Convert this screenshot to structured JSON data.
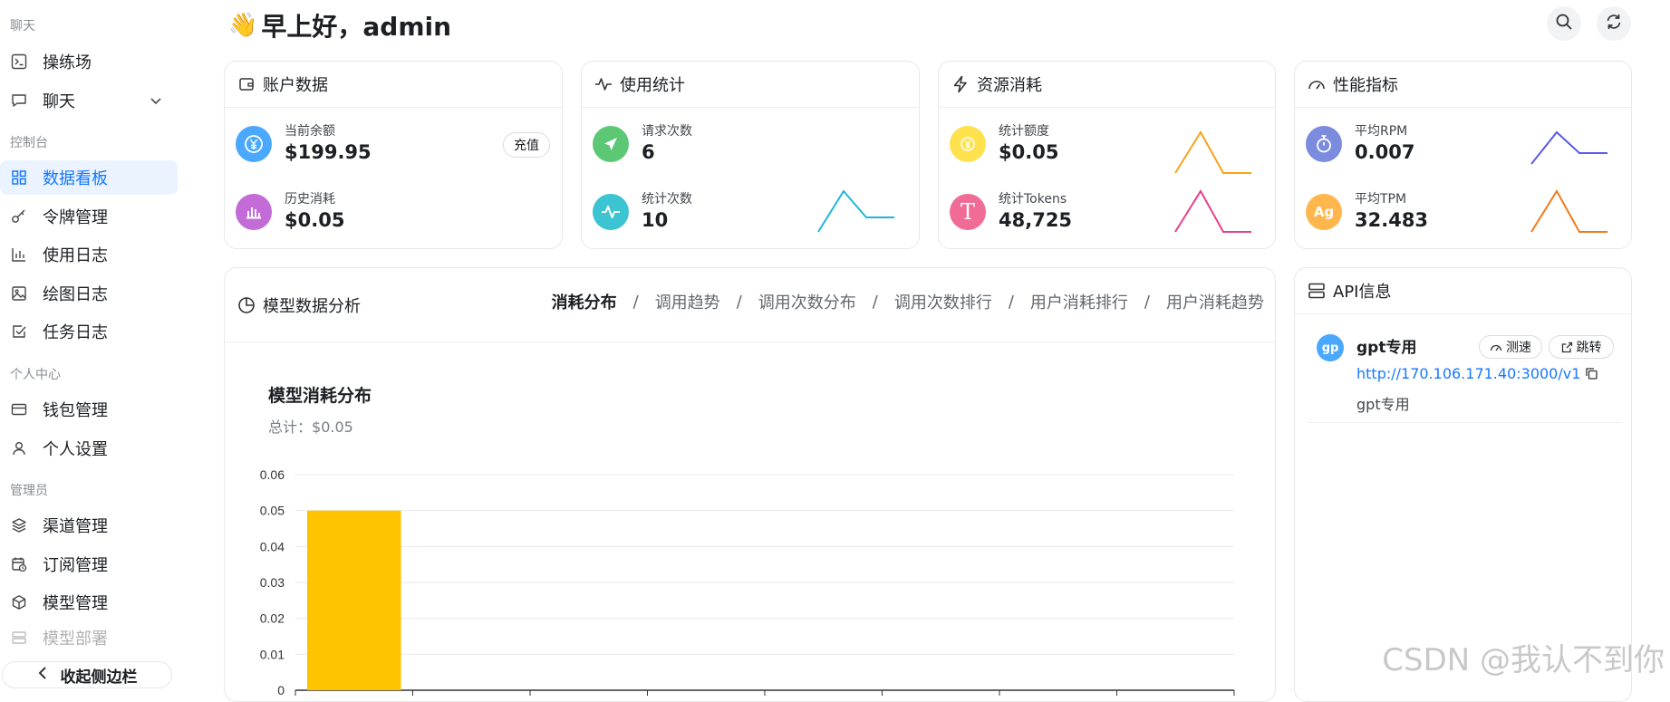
{
  "sidebar": {
    "sections": [
      {
        "title": "聊天",
        "items": [
          {
            "label": "操练场",
            "icon": "terminal-icon"
          },
          {
            "label": "聊天",
            "icon": "chat-bubble-icon",
            "expandable": true
          }
        ]
      },
      {
        "title": "控制台",
        "items": [
          {
            "label": "数据看板",
            "icon": "dashboard-grid-icon",
            "active": true
          },
          {
            "label": "令牌管理",
            "icon": "key-icon"
          },
          {
            "label": "使用日志",
            "icon": "bar-chart-icon"
          },
          {
            "label": "绘图日志",
            "icon": "image-icon"
          },
          {
            "label": "任务日志",
            "icon": "checkbox-icon"
          }
        ]
      },
      {
        "title": "个人中心",
        "items": [
          {
            "label": "钱包管理",
            "icon": "credit-card-icon"
          },
          {
            "label": "个人设置",
            "icon": "user-icon"
          }
        ]
      },
      {
        "title": "管理员",
        "items": [
          {
            "label": "渠道管理",
            "icon": "layers-icon"
          },
          {
            "label": "订阅管理",
            "icon": "calendar-clock-icon"
          },
          {
            "label": "模型管理",
            "icon": "cube-icon"
          },
          {
            "label": "模型部署",
            "icon": "server-icon"
          }
        ]
      }
    ],
    "collapse_label": "收起侧边栏"
  },
  "header": {
    "wave_emoji": "👋",
    "greeting": "早上好，admin",
    "search_icon": "search-icon",
    "refresh_icon": "refresh-icon"
  },
  "cards": {
    "account": {
      "title": "账户数据",
      "balance_label": "当前余额",
      "balance_value": "$199.95",
      "recharge_label": "充值",
      "history_label": "历史消耗",
      "history_value": "$0.05"
    },
    "usage": {
      "title": "使用统计",
      "requests_label": "请求次数",
      "requests_value": "6",
      "stats_label": "统计次数",
      "stats_value": "10"
    },
    "resource": {
      "title": "资源消耗",
      "quota_label": "统计额度",
      "quota_value": "$0.05",
      "tokens_label": "统计Tokens",
      "tokens_value": "48,725"
    },
    "performance": {
      "title": "性能指标",
      "rpm_label": "平均RPM",
      "rpm_value": "0.007",
      "tpm_label": "平均TPM",
      "tpm_value": "32.483",
      "tpm_badge": "Ag"
    }
  },
  "analysis": {
    "title": "模型数据分析",
    "tabs": [
      "消耗分布",
      "调用趋势",
      "调用次数分布",
      "调用次数排行",
      "用户消耗排行",
      "用户消耗趋势"
    ],
    "active_tab": 0,
    "chart_title": "模型消耗分布",
    "chart_subtitle_prefix": "总计：",
    "chart_subtitle_value": "$0.05"
  },
  "api_info": {
    "title": "API信息",
    "entry": {
      "avatar": "gp",
      "name": "gpt专用",
      "speedtest_label": "测速",
      "jump_label": "跳转",
      "url": "http://170.106.171.40:3000/v1",
      "description": "gpt专用"
    }
  },
  "watermark": "CSDN @我认不到你",
  "colors": {
    "accent": "#1677ff",
    "bar": "#ffc300",
    "balance_icon": "#4aa8ff",
    "history_icon": "#c36bd6",
    "requests_icon": "#5cc774",
    "stats_icon": "#3cc4d2",
    "quota_icon": "#ffe14d",
    "tokens_icon": "#f06b95",
    "rpm_icon": "#7b8cdf",
    "tpm_icon": "#ffb74d"
  },
  "chart_data": {
    "type": "bar",
    "title": "模型消耗分布",
    "subtitle": "总计：$0.05",
    "categories": [
      "",
      "",
      "",
      "",
      "",
      "",
      "",
      ""
    ],
    "values": [
      0.05,
      0,
      0,
      0,
      0,
      0,
      0,
      0
    ],
    "ylim": [
      0,
      0.06
    ],
    "yticks": [
      "0.06",
      "0.05",
      "0.04",
      "0.03",
      "0.02",
      "0.01",
      "0"
    ],
    "grid": true,
    "xlabel": "",
    "ylabel": ""
  }
}
